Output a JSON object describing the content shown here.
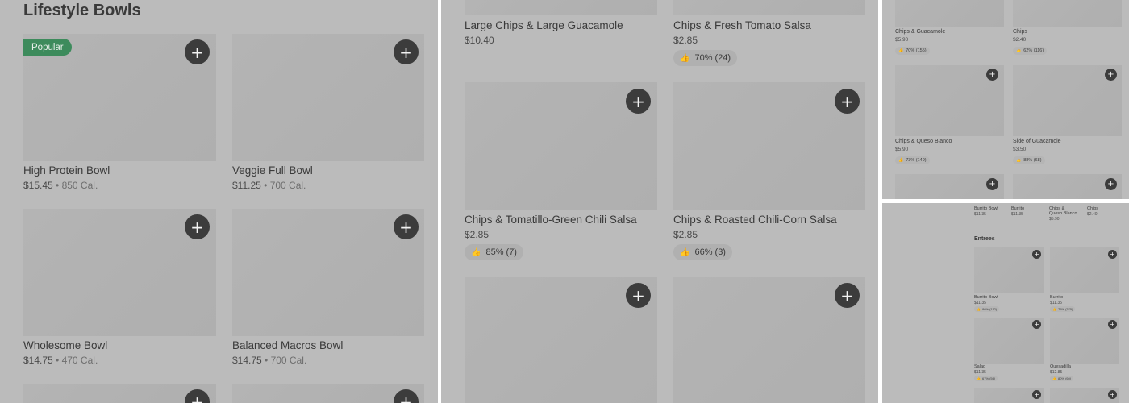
{
  "panel1": {
    "section_title": "Lifestyle Bowls",
    "badge": "Popular",
    "items": [
      {
        "name": "High Protein Bowl",
        "price": "$15.45",
        "calories": "850 Cal."
      },
      {
        "name": "Veggie Full Bowl",
        "price": "$11.25",
        "calories": "700 Cal."
      },
      {
        "name": "Wholesome Bowl",
        "price": "$14.75",
        "calories": "470 Cal."
      },
      {
        "name": "Balanced Macros Bowl",
        "price": "$14.75",
        "calories": "700 Cal."
      }
    ]
  },
  "panel2": {
    "items": [
      {
        "name": "Large Chips & Large Guacamole",
        "price": "$10.40",
        "rating": ""
      },
      {
        "name": "Chips & Fresh Tomato Salsa",
        "price": "$2.85",
        "rating": "70% (24)"
      },
      {
        "name": "Chips & Tomatillo-Green Chili Salsa",
        "price": "$2.85",
        "rating": "85% (7)"
      },
      {
        "name": "Chips & Roasted Chili-Corn Salsa",
        "price": "$2.85",
        "rating": "66% (3)"
      }
    ]
  },
  "panel3": {
    "items": [
      {
        "name": "Chips & Guacamole",
        "price": "$5.90",
        "rating": "70% (155)"
      },
      {
        "name": "Chips",
        "price": "$2.40",
        "rating": "62% (116)"
      },
      {
        "name": "Chips & Queso Blanco",
        "price": "$5.90",
        "rating": "73% (149)"
      },
      {
        "name": "Side of Guacamole",
        "price": "$3.50",
        "rating": "88% (68)"
      }
    ]
  },
  "panel4": {
    "top_row": [
      {
        "name": "Burrito Bowl",
        "price": "$11.35"
      },
      {
        "name": "Burrito",
        "price": "$11.35"
      },
      {
        "name": "Chips & Queso Blanco",
        "price": "$5.90"
      },
      {
        "name": "Chips",
        "price": "$2.40"
      }
    ],
    "section_title": "Entrees",
    "items": [
      {
        "name": "Burrito Bowl",
        "price": "$11.35",
        "rating": "86% (112)"
      },
      {
        "name": "Burrito",
        "price": "$11.35",
        "rating": "75% (375)"
      },
      {
        "name": "Salad",
        "price": "$11.35",
        "rating": "67% (56)"
      },
      {
        "name": "Quesadilla",
        "price": "$12.85",
        "rating": "80% (60)"
      }
    ]
  },
  "icons": {
    "add": "plus-icon",
    "rating": "thumbs-up-icon"
  },
  "colors": {
    "badge_green": "#3d8b5c",
    "add_button": "#3c3c3c",
    "overlay_gray": "#bbbbbb"
  },
  "glyphs": {
    "plus": "+",
    "thumb": "👍",
    "dot": " • "
  }
}
